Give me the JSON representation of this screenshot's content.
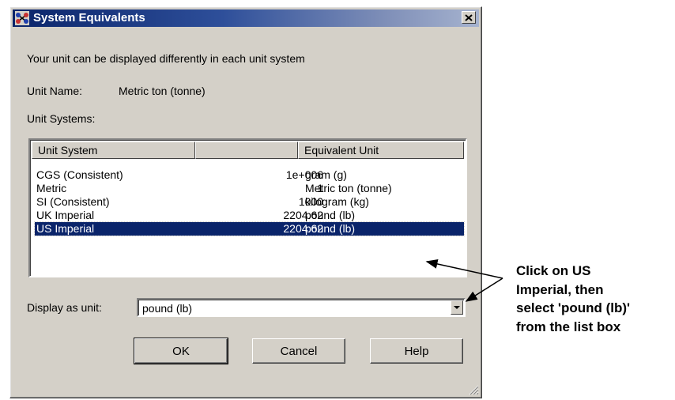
{
  "window": {
    "title": "System Equivalents",
    "close_label": "✕"
  },
  "intro_text": "Your unit can be displayed differently in each unit system",
  "unit_name": {
    "label": "Unit Name:",
    "value": "Metric ton (tonne)"
  },
  "unit_systems_label": "Unit Systems:",
  "table": {
    "columns": [
      "Unit System",
      "",
      "Equivalent Unit"
    ],
    "rows": [
      {
        "system": "CGS (Consistent)",
        "factor": "1e+006",
        "unit": "gram (g)",
        "selected": false
      },
      {
        "system": "Metric",
        "factor": "1",
        "unit": "Metric ton (tonne)",
        "selected": false
      },
      {
        "system": "SI (Consistent)",
        "factor": "1000",
        "unit": "kilogram (kg)",
        "selected": false
      },
      {
        "system": "UK Imperial",
        "factor": "2204.62",
        "unit": "pound (lb)",
        "selected": false
      },
      {
        "system": "US Imperial",
        "factor": "2204.62",
        "unit": "pound (lb)",
        "selected": true
      }
    ]
  },
  "display_as": {
    "label": "Display as unit:",
    "value": "pound (lb)"
  },
  "buttons": {
    "ok": "OK",
    "cancel": "Cancel",
    "help": "Help"
  },
  "callout_text": "Click on US\nImperial, then\nselect 'pound (lb)'\nfrom the list box",
  "colors": {
    "dialog_face": "#d4d0c8",
    "titlebar_start": "#0a246a",
    "selection": "#0a246a"
  }
}
